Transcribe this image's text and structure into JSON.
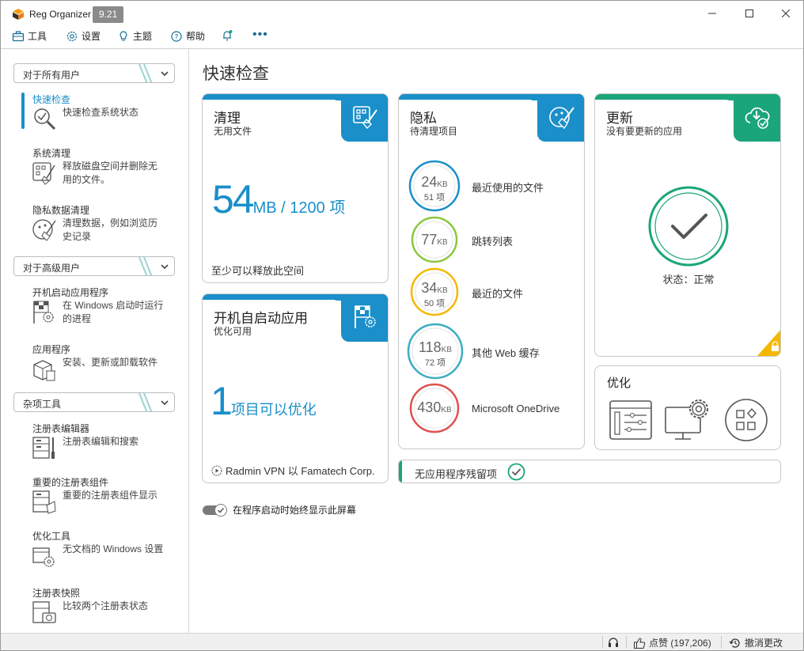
{
  "window": {
    "title": "Reg Organizer",
    "version": "9.21"
  },
  "menu": {
    "tools": "工具",
    "settings": "设置",
    "theme": "主题",
    "help": "帮助"
  },
  "sidebar": {
    "groups": [
      {
        "label": "对于所有用户"
      },
      {
        "label": "对于高级用户"
      },
      {
        "label": "杂项工具"
      }
    ],
    "items": [
      {
        "title": "快速检查",
        "desc": "快速检查系统状态"
      },
      {
        "title": "系统清理",
        "desc": "释放磁盘空间并删除无用的文件。"
      },
      {
        "title": "隐私数据清理",
        "desc": "清理数据，例如浏览历史记录"
      },
      {
        "title": "开机启动应用程序",
        "desc": "在 Windows 启动时运行的进程"
      },
      {
        "title": "应用程序",
        "desc": "安装、更新或卸载软件"
      },
      {
        "title": "注册表编辑器",
        "desc": "注册表编辑和搜索"
      },
      {
        "title": "重要的注册表组件",
        "desc": "重要的注册表组件显示"
      },
      {
        "title": "优化工具",
        "desc": "无文档的 Windows 设置"
      },
      {
        "title": "注册表快照",
        "desc": "比较两个注册表状态"
      }
    ]
  },
  "main": {
    "title": "快速检查",
    "cleanup": {
      "title": "清理",
      "subtitle": "无用文件",
      "amount": "54",
      "unit": "MB / 1200 项",
      "note": "至少可以释放此空间"
    },
    "startup": {
      "title": "开机自启动应用",
      "subtitle": "优化可用",
      "count": "1",
      "text": "项目可以优化",
      "footer": "Radmin VPN 以 Famatech Corp."
    },
    "privacy": {
      "title": "隐私",
      "subtitle": "待清理项目",
      "rows": [
        {
          "value": "24",
          "unit": "KB",
          "count": "51 项",
          "label": "最近使用的文件",
          "color": "#1a8fc9"
        },
        {
          "value": "77",
          "unit": "KB",
          "count": "",
          "label": "跳转列表",
          "color": "#8cc63f"
        },
        {
          "value": "34",
          "unit": "KB",
          "count": "50 项",
          "label": "最近的文件",
          "color": "#f5b800"
        },
        {
          "value": "118",
          "unit": "KB",
          "count": "72 项",
          "label": "其他 Web 缓存",
          "color": "#3aaec2"
        },
        {
          "value": "430",
          "unit": "KB",
          "count": "",
          "label": "Microsoft OneDrive",
          "color": "#e05050"
        }
      ]
    },
    "update": {
      "title": "更新",
      "subtitle": "没有要更新的应用",
      "status": "状态：正常"
    },
    "optimize": {
      "title": "优化"
    },
    "leftovers": {
      "label": "无应用程序残留项"
    },
    "toggle_label": "在程序启动时始终显示此屏幕"
  },
  "statusbar": {
    "likes": "点赞 (197,206)",
    "undo": "撤消更改"
  },
  "colors": {
    "accent": "#1a8fc9",
    "update_green": "#1aa57a",
    "lock_yellow": "#f5b800"
  }
}
